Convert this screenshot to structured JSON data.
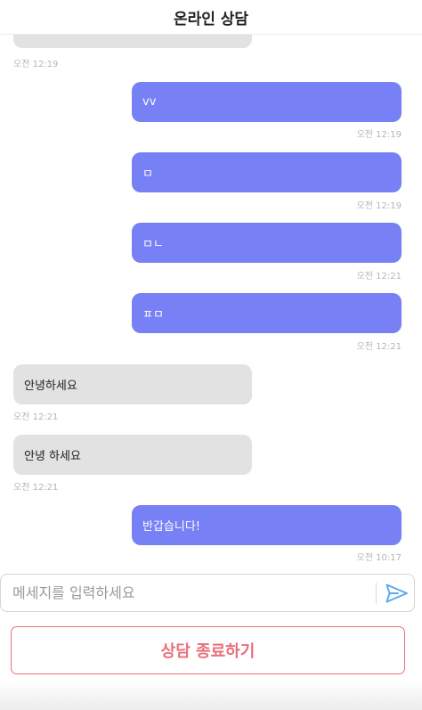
{
  "header": {
    "title": "온라인 상담"
  },
  "messages": [
    {
      "side": "received",
      "text": "",
      "time": "오전 12:19"
    },
    {
      "side": "sent",
      "text": "vv",
      "time": "오전 12:19"
    },
    {
      "side": "sent",
      "text": "ㅁ",
      "time": "오전 12:19"
    },
    {
      "side": "sent",
      "text": "ㅁㄴ",
      "time": "오전 12:21"
    },
    {
      "side": "sent",
      "text": "ㅍㅁ",
      "time": "오전 12:21"
    },
    {
      "side": "received",
      "text": "안녕하세요",
      "time": "오전 12:21"
    },
    {
      "side": "received",
      "text": "안녕 하세요",
      "time": "오전 12:21"
    },
    {
      "side": "sent",
      "text": "반갑습니다!",
      "time": "오전 10:17"
    }
  ],
  "composer": {
    "placeholder": "메세지를 입력하세요",
    "send_icon": "send-icon"
  },
  "actions": {
    "end_consultation_label": "상담 종료하기"
  },
  "colors": {
    "sent_bubble": "#7780f5",
    "received_bubble": "#e2e2e2",
    "end_button": "#e8707c",
    "send_icon": "#5aa9f0"
  }
}
